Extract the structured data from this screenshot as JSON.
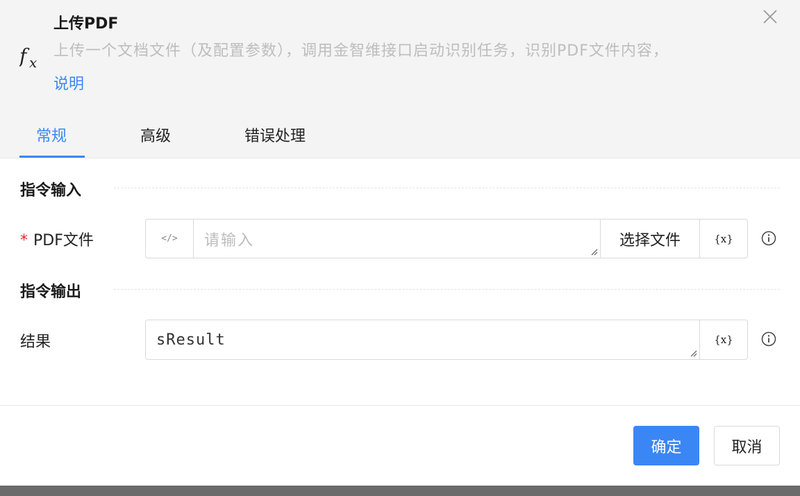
{
  "header": {
    "title": "上传PDF",
    "description": "上传一个文档文件（及配置参数），调用金智维接口启动识别任务，识别PDF文件内容，",
    "help_link": "说明",
    "icon": "function-icon",
    "close_icon": "close-icon"
  },
  "tabs": [
    {
      "label": "常规",
      "active": true
    },
    {
      "label": "高级",
      "active": false
    },
    {
      "label": "错误处理",
      "active": false
    }
  ],
  "sections": {
    "input_title": "指令输入",
    "output_title": "指令输出"
  },
  "fields": {
    "pdf_file": {
      "required_mark": "*",
      "label": "PDF文件",
      "placeholder": "请输入",
      "value": "",
      "code_toggle": "</>",
      "select_button": "选择文件",
      "var_button": "{x}"
    },
    "result": {
      "label": "结果",
      "value": "sResult",
      "var_button": "{x}"
    }
  },
  "footer": {
    "ok_label": "确定",
    "cancel_label": "取消"
  },
  "colors": {
    "accent": "#3b86f5",
    "required": "#e0282e",
    "header_bg": "#f4f4f4"
  }
}
